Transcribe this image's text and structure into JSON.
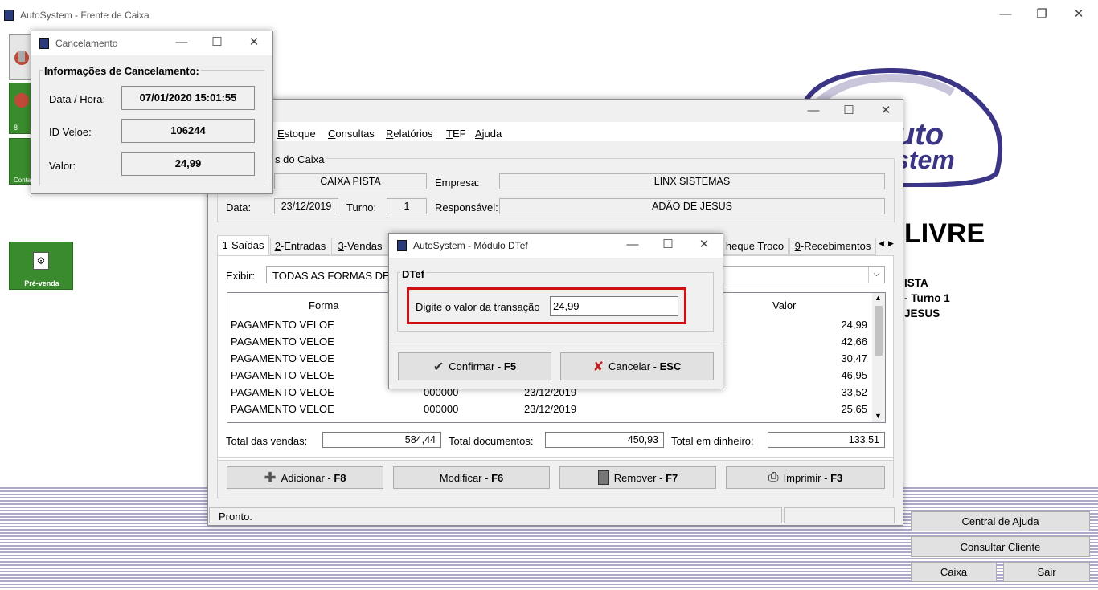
{
  "main": {
    "title": "AutoSystem - Frente de Caixa",
    "logo_text": "AUTO SYSTEM",
    "status_big": "LIVRE",
    "side_info": [
      "ISTA",
      "- Turno 1",
      "JESUS"
    ],
    "side_buttons": {
      "b8": "8",
      "conta": "Conta",
      "pre_venda": "Pré-venda"
    },
    "bottom_buttons": {
      "help": "Central de Ajuda",
      "client": "Consultar Cliente",
      "caixa": "Caixa",
      "sair": "Sair"
    }
  },
  "caixa_window": {
    "menu": [
      {
        "label": "Estoque",
        "key": "E"
      },
      {
        "label": "Consultas",
        "key": "C"
      },
      {
        "label": "Relatórios",
        "key": "R"
      },
      {
        "label": "TEF",
        "key": "T"
      },
      {
        "label": "Ajuda",
        "key": "A"
      }
    ],
    "group_title": "s do Caixa",
    "caixa": "CAIXA PISTA",
    "empresa_label": "Empresa:",
    "empresa": "LINX SISTEMAS",
    "data_label": "Data:",
    "data": "23/12/2019",
    "turno_label": "Turno:",
    "turno": "1",
    "responsavel_label": "Responsável:",
    "responsavel": "ADÃO DE JESUS",
    "tabs": [
      "1-Saídas",
      "2-Entradas",
      "3-Vendas",
      "heque Troco",
      "9-Recebimentos"
    ],
    "exibir_label": "Exibir:",
    "exibir_value": "TODAS AS FORMAS DE R",
    "columns": {
      "forma": "Forma",
      "valor": "Valor"
    },
    "rows": [
      {
        "forma": "PAGAMENTO VELOE",
        "doc": "",
        "data": "",
        "valor": "24,99"
      },
      {
        "forma": "PAGAMENTO VELOE",
        "doc": "",
        "data": "",
        "valor": "42,66"
      },
      {
        "forma": "PAGAMENTO VELOE",
        "doc": "",
        "data": "",
        "valor": "30,47"
      },
      {
        "forma": "PAGAMENTO VELOE",
        "doc": "",
        "data": "",
        "valor": "46,95"
      },
      {
        "forma": "PAGAMENTO VELOE",
        "doc": "000000",
        "data": "23/12/2019",
        "valor": "33,52"
      },
      {
        "forma": "PAGAMENTO VELOE",
        "doc": "000000",
        "data": "23/12/2019",
        "valor": "25,65"
      }
    ],
    "total_vendas_label": "Total das vendas:",
    "total_vendas": "584,44",
    "total_docs_label": "Total documentos:",
    "total_docs": "450,93",
    "total_dinheiro_label": "Total em dinheiro:",
    "total_dinheiro": "133,51",
    "buttons": {
      "add": "Adicionar - ",
      "add_key": "F8",
      "mod": "Modificar - ",
      "mod_key": "F6",
      "rem": "Remover - ",
      "rem_key": "F7",
      "print": "Imprimir - ",
      "print_key": "F3"
    },
    "status": "Pronto."
  },
  "cancel_window": {
    "title": "Cancelamento",
    "group_title": "Informações de Cancelamento:",
    "data_hora_label": "Data / Hora:",
    "data_hora": "07/01/2020 15:01:55",
    "id_label": "ID Veloe:",
    "id": "106244",
    "valor_label": "Valor:",
    "valor": "24,99"
  },
  "dtef_window": {
    "title": "AutoSystem - Módulo DTef",
    "group_title": "DTef",
    "prompt": "Digite o valor da transação",
    "value": "24,99",
    "confirm": "Confirmar - ",
    "confirm_key": "F5",
    "cancel": "Cancelar - ",
    "cancel_key": "ESC"
  },
  "colors": {
    "green": "#3a8a2e",
    "highlight": "#d01010",
    "stripe": "#a9a3c6",
    "logo": "#3b3585"
  }
}
